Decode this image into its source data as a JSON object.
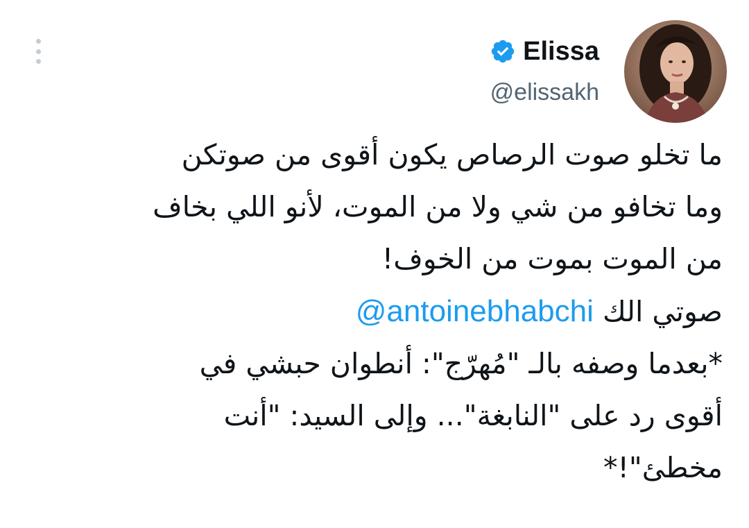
{
  "author": {
    "display_name": "Elissa",
    "handle": "@elissakh",
    "verified": true,
    "avatar_icon": "profile-photo"
  },
  "colors": {
    "verified_badge": "#1d9bf0",
    "mention": "#1d9bf0",
    "handle": "#536471",
    "text": "#0f1419"
  },
  "tweet": {
    "lines": [
      "ما تخلو صوت الرصاص يكون أقوى من صوتكن",
      "وما تخافو من شي ولا من الموت، لأنو اللي بخاف",
      "من الموت بموت من الخوف!"
    ],
    "mention_prefix": "صوتي الك",
    "mention": "@antoinebhabchi",
    "headline_lines": [
      "*بعدما وصفه بالـ \"مُهرّج\": أنطوان حبشي في",
      "أقوى رد على \"النابغة\"... وإلى السيد: \"أنت",
      "مخطئ\"!*"
    ]
  }
}
